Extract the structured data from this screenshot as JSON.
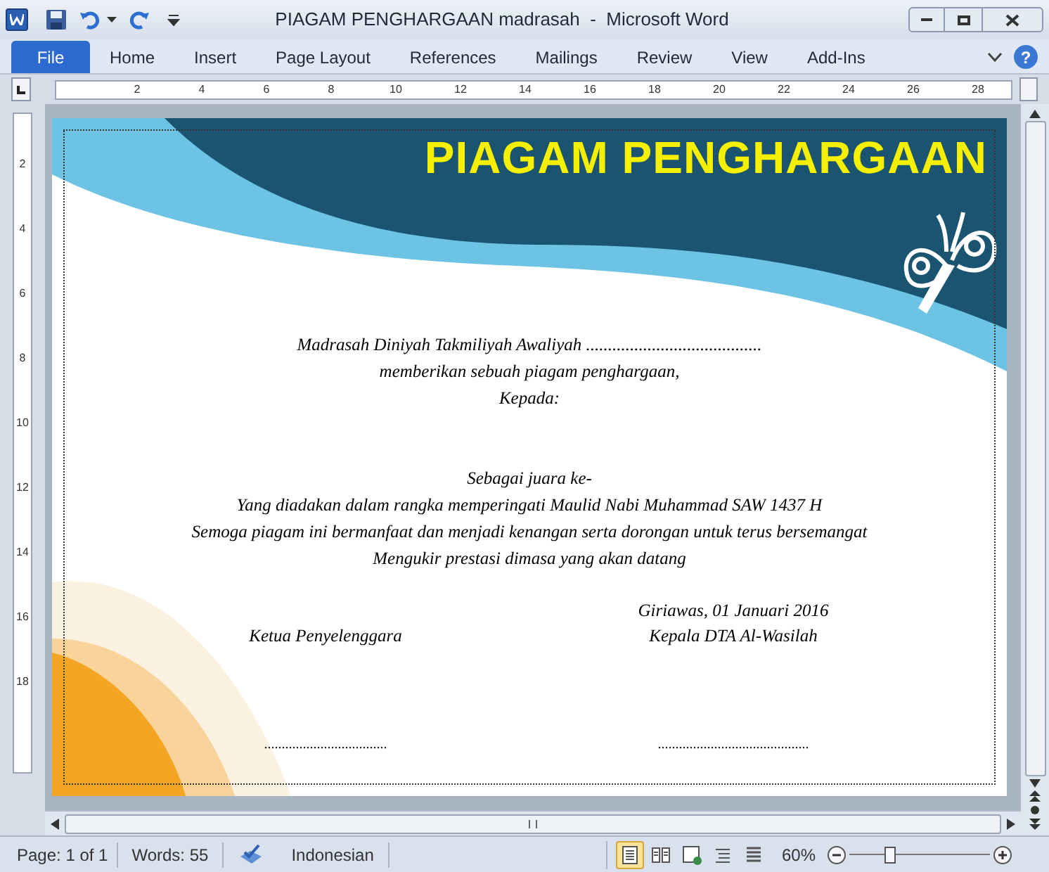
{
  "window": {
    "title": "PIAGAM PENGHARGAAN madrasah  -  Microsoft Word"
  },
  "tabs": [
    {
      "label": "File",
      "kind": "file",
      "selected": false
    },
    {
      "label": "Home",
      "kind": "tab",
      "selected": false
    },
    {
      "label": "Insert",
      "kind": "tab",
      "selected": false
    },
    {
      "label": "Page Layout",
      "kind": "tab",
      "selected": false
    },
    {
      "label": "References",
      "kind": "tab",
      "selected": false
    },
    {
      "label": "Mailings",
      "kind": "tab",
      "selected": false
    },
    {
      "label": "Review",
      "kind": "tab",
      "selected": false
    },
    {
      "label": "View",
      "kind": "tab",
      "selected": false
    },
    {
      "label": "Add-Ins",
      "kind": "tab",
      "selected": false
    }
  ],
  "help": {
    "label": "?"
  },
  "ruler": {
    "horizontal": [
      "2",
      "4",
      "6",
      "8",
      "10",
      "12",
      "14",
      "16",
      "18",
      "20",
      "22",
      "24",
      "26",
      "28"
    ],
    "vertical": [
      "2",
      "4",
      "6",
      "8",
      "10",
      "12",
      "14",
      "16",
      "18"
    ]
  },
  "document": {
    "title": "PIAGAM PENGHARGAAN",
    "intro": [
      "Madrasah Diniyah Takmiliyah Awaliyah ........................................",
      "memberikan sebuah piagam penghargaan,",
      "Kepada:"
    ],
    "body": [
      "Sebagai juara ke-",
      "Yang diadakan dalam rangka memperingati Maulid Nabi Muhammad SAW 1437 H",
      "Semoga piagam ini bermanfaat dan menjadi kenangan serta dorongan untuk terus bersemangat",
      "Mengukir prestasi dimasa yang akan datang"
    ],
    "signatures": [
      {
        "role": "Ketua Penyelenggara",
        "line": "..................................."
      },
      {
        "date": "Giriawas, 01 Januari 2016",
        "role": "Kepala DTA Al-Wasilah",
        "line": "..........................................."
      }
    ]
  },
  "status_bar": {
    "page": "Page: 1 of 1",
    "words": "Words: 55",
    "language": "Indonesian",
    "views": [
      {
        "selected": true
      },
      {
        "selected": false
      },
      {
        "selected": false
      },
      {
        "selected": false
      },
      {
        "selected": false
      }
    ],
    "zoom": "60%",
    "zoom_slider": {
      "level": 0.29
    }
  }
}
